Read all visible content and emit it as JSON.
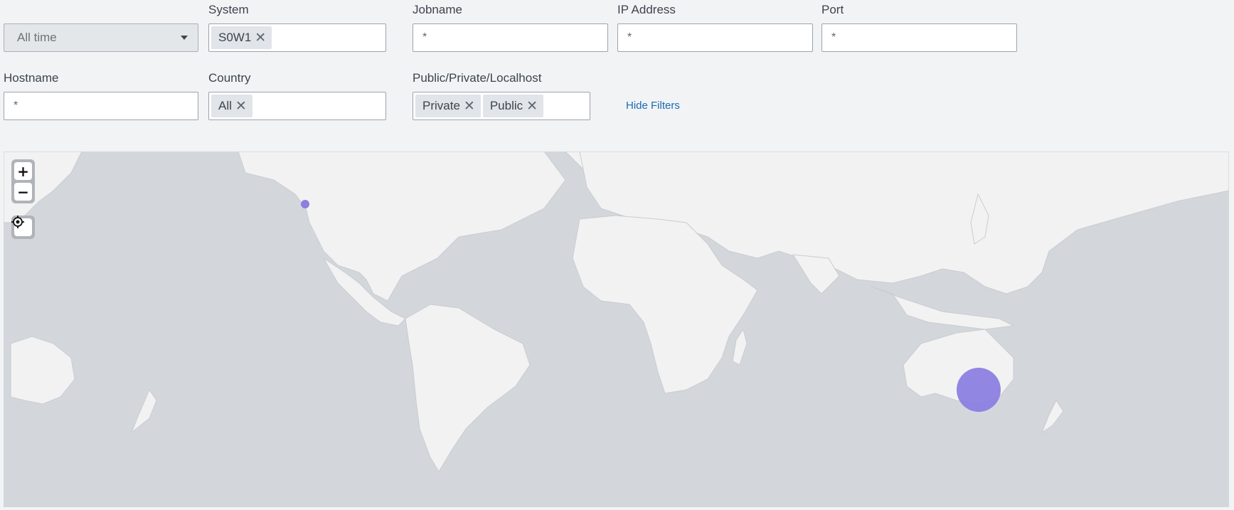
{
  "filters": {
    "time": {
      "selected": "All time"
    },
    "system": {
      "label": "System",
      "chips": [
        "S0W1"
      ]
    },
    "jobname": {
      "label": "Jobname",
      "value": "*"
    },
    "ip_address": {
      "label": "IP Address",
      "value": "*"
    },
    "port": {
      "label": "Port",
      "value": "*"
    },
    "hostname": {
      "label": "Hostname",
      "value": "*"
    },
    "country": {
      "label": "Country",
      "chips": [
        "All"
      ]
    },
    "scope": {
      "label": "Public/Private/Localhost",
      "chips": [
        "Private",
        "Public"
      ]
    },
    "hide_filters_label": "Hide Filters"
  },
  "map": {
    "controls": {
      "zoom_in_icon": "plus-icon",
      "zoom_out_icon": "minus-icon",
      "locate_icon": "crosshair-icon"
    },
    "markers": [
      {
        "name": "california-marker",
        "size": "small"
      },
      {
        "name": "australia-marker",
        "size": "large"
      }
    ],
    "colors": {
      "ocean": "#d3d7dc",
      "land": "#f2f2f2",
      "marker": "#8b7fe0"
    }
  }
}
